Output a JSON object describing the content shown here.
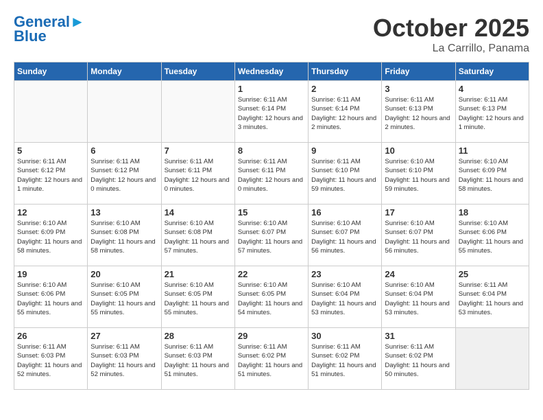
{
  "header": {
    "logo_line1": "General",
    "logo_line2": "Blue",
    "month": "October 2025",
    "location": "La Carrillo, Panama"
  },
  "days_of_week": [
    "Sunday",
    "Monday",
    "Tuesday",
    "Wednesday",
    "Thursday",
    "Friday",
    "Saturday"
  ],
  "weeks": [
    [
      {
        "num": "",
        "info": ""
      },
      {
        "num": "",
        "info": ""
      },
      {
        "num": "",
        "info": ""
      },
      {
        "num": "1",
        "info": "Sunrise: 6:11 AM\nSunset: 6:14 PM\nDaylight: 12 hours and 3 minutes."
      },
      {
        "num": "2",
        "info": "Sunrise: 6:11 AM\nSunset: 6:14 PM\nDaylight: 12 hours and 2 minutes."
      },
      {
        "num": "3",
        "info": "Sunrise: 6:11 AM\nSunset: 6:13 PM\nDaylight: 12 hours and 2 minutes."
      },
      {
        "num": "4",
        "info": "Sunrise: 6:11 AM\nSunset: 6:13 PM\nDaylight: 12 hours and 1 minute."
      }
    ],
    [
      {
        "num": "5",
        "info": "Sunrise: 6:11 AM\nSunset: 6:12 PM\nDaylight: 12 hours and 1 minute."
      },
      {
        "num": "6",
        "info": "Sunrise: 6:11 AM\nSunset: 6:12 PM\nDaylight: 12 hours and 0 minutes."
      },
      {
        "num": "7",
        "info": "Sunrise: 6:11 AM\nSunset: 6:11 PM\nDaylight: 12 hours and 0 minutes."
      },
      {
        "num": "8",
        "info": "Sunrise: 6:11 AM\nSunset: 6:11 PM\nDaylight: 12 hours and 0 minutes."
      },
      {
        "num": "9",
        "info": "Sunrise: 6:11 AM\nSunset: 6:10 PM\nDaylight: 11 hours and 59 minutes."
      },
      {
        "num": "10",
        "info": "Sunrise: 6:10 AM\nSunset: 6:10 PM\nDaylight: 11 hours and 59 minutes."
      },
      {
        "num": "11",
        "info": "Sunrise: 6:10 AM\nSunset: 6:09 PM\nDaylight: 11 hours and 58 minutes."
      }
    ],
    [
      {
        "num": "12",
        "info": "Sunrise: 6:10 AM\nSunset: 6:09 PM\nDaylight: 11 hours and 58 minutes."
      },
      {
        "num": "13",
        "info": "Sunrise: 6:10 AM\nSunset: 6:08 PM\nDaylight: 11 hours and 58 minutes."
      },
      {
        "num": "14",
        "info": "Sunrise: 6:10 AM\nSunset: 6:08 PM\nDaylight: 11 hours and 57 minutes."
      },
      {
        "num": "15",
        "info": "Sunrise: 6:10 AM\nSunset: 6:07 PM\nDaylight: 11 hours and 57 minutes."
      },
      {
        "num": "16",
        "info": "Sunrise: 6:10 AM\nSunset: 6:07 PM\nDaylight: 11 hours and 56 minutes."
      },
      {
        "num": "17",
        "info": "Sunrise: 6:10 AM\nSunset: 6:07 PM\nDaylight: 11 hours and 56 minutes."
      },
      {
        "num": "18",
        "info": "Sunrise: 6:10 AM\nSunset: 6:06 PM\nDaylight: 11 hours and 55 minutes."
      }
    ],
    [
      {
        "num": "19",
        "info": "Sunrise: 6:10 AM\nSunset: 6:06 PM\nDaylight: 11 hours and 55 minutes."
      },
      {
        "num": "20",
        "info": "Sunrise: 6:10 AM\nSunset: 6:05 PM\nDaylight: 11 hours and 55 minutes."
      },
      {
        "num": "21",
        "info": "Sunrise: 6:10 AM\nSunset: 6:05 PM\nDaylight: 11 hours and 55 minutes."
      },
      {
        "num": "22",
        "info": "Sunrise: 6:10 AM\nSunset: 6:05 PM\nDaylight: 11 hours and 54 minutes."
      },
      {
        "num": "23",
        "info": "Sunrise: 6:10 AM\nSunset: 6:04 PM\nDaylight: 11 hours and 53 minutes."
      },
      {
        "num": "24",
        "info": "Sunrise: 6:10 AM\nSunset: 6:04 PM\nDaylight: 11 hours and 53 minutes."
      },
      {
        "num": "25",
        "info": "Sunrise: 6:11 AM\nSunset: 6:04 PM\nDaylight: 11 hours and 53 minutes."
      }
    ],
    [
      {
        "num": "26",
        "info": "Sunrise: 6:11 AM\nSunset: 6:03 PM\nDaylight: 11 hours and 52 minutes."
      },
      {
        "num": "27",
        "info": "Sunrise: 6:11 AM\nSunset: 6:03 PM\nDaylight: 11 hours and 52 minutes."
      },
      {
        "num": "28",
        "info": "Sunrise: 6:11 AM\nSunset: 6:03 PM\nDaylight: 11 hours and 51 minutes."
      },
      {
        "num": "29",
        "info": "Sunrise: 6:11 AM\nSunset: 6:02 PM\nDaylight: 11 hours and 51 minutes."
      },
      {
        "num": "30",
        "info": "Sunrise: 6:11 AM\nSunset: 6:02 PM\nDaylight: 11 hours and 51 minutes."
      },
      {
        "num": "31",
        "info": "Sunrise: 6:11 AM\nSunset: 6:02 PM\nDaylight: 11 hours and 50 minutes."
      },
      {
        "num": "",
        "info": ""
      }
    ]
  ]
}
